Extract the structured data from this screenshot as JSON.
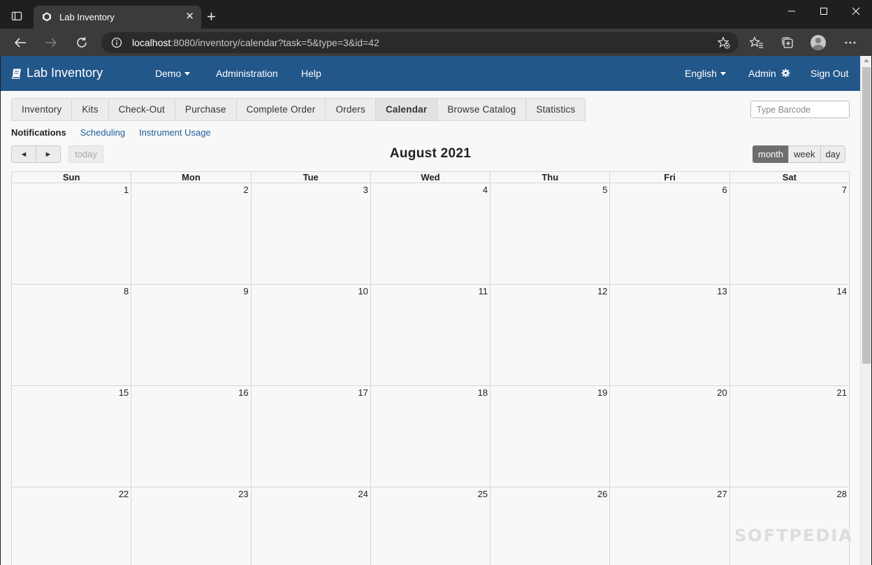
{
  "browser": {
    "tab_title": "Lab Inventory",
    "url_host": "localhost",
    "url_rest": ":8080/inventory/calendar?task=5&type=3&id=42"
  },
  "navbar": {
    "brand": "Lab Inventory",
    "demo": "Demo",
    "administration": "Administration",
    "help": "Help",
    "language": "English",
    "admin": "Admin",
    "sign_out": "Sign Out",
    "bg_color": "#22578a"
  },
  "tabs": [
    "Inventory",
    "Kits",
    "Check-Out",
    "Purchase",
    "Complete Order",
    "Orders",
    "Calendar",
    "Browse Catalog",
    "Statistics"
  ],
  "active_tab": "Calendar",
  "barcode_placeholder": "Type Barcode",
  "subnav": {
    "active": "Notifications",
    "links": [
      "Scheduling",
      "Instrument Usage"
    ]
  },
  "calendar": {
    "prev_label": "◄",
    "next_label": "►",
    "today_label": "today",
    "title": "August 2021",
    "views": [
      "month",
      "week",
      "day"
    ],
    "active_view": "month",
    "weekdays": [
      "Sun",
      "Mon",
      "Tue",
      "Wed",
      "Thu",
      "Fri",
      "Sat"
    ],
    "days": [
      "1",
      "2",
      "3",
      "4",
      "5",
      "6",
      "7",
      "8",
      "9",
      "10",
      "11",
      "12",
      "13",
      "14",
      "15",
      "16",
      "17",
      "18",
      "19",
      "20",
      "21",
      "22",
      "23",
      "24",
      "25",
      "26",
      "27",
      "28"
    ]
  },
  "watermark": "SOFTPEDIA"
}
